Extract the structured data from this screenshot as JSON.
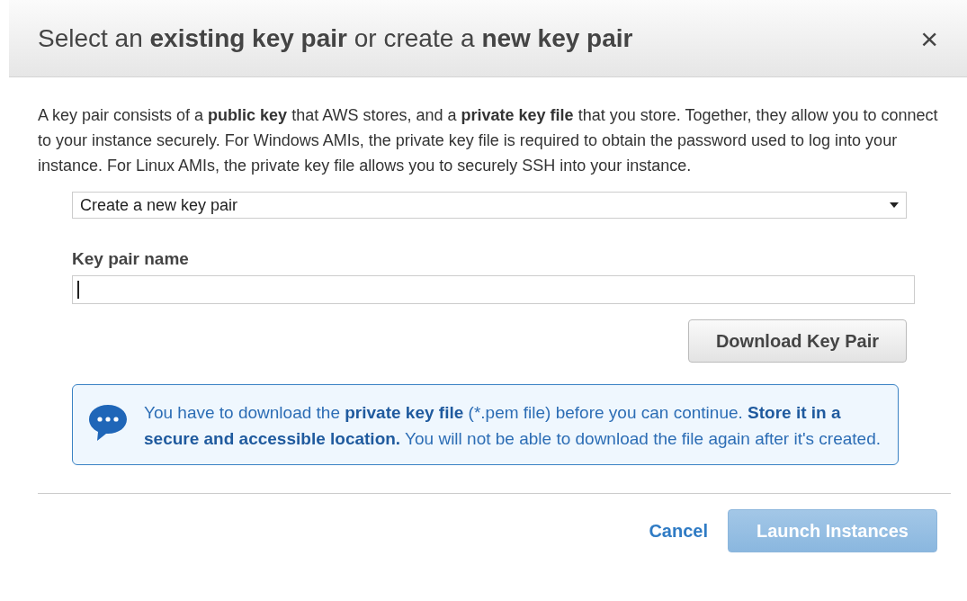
{
  "dialog": {
    "title": "Select an **existing key pair** or create a **new key pair**",
    "close": "×"
  },
  "description": "A key pair consists of a **public key** that AWS stores, and a **private key file** that you store. Together, they allow you to connect to your instance securely. For Windows AMIs, the private key file is required to obtain the password used to log into your instance. For Linux AMIs, the private key file allows you to securely SSH into your instance.",
  "key_pair_select": {
    "value": "Create a new key pair"
  },
  "key_pair_name": {
    "label": "Key pair name",
    "focused": true
  },
  "download_button": {
    "label": "Download Key Pair"
  },
  "info": {
    "text": "You have to download the **private key file** (*.pem file) before you can continue. **Store it in a secure and accessible location.** You will not be able to download the file again after it's created."
  },
  "footer": {
    "buttons": [
      {
        "kind": "link",
        "label": "Cancel",
        "disabled": false
      },
      {
        "kind": "primary",
        "label": "Launch Instances",
        "disabled": true
      }
    ]
  }
}
